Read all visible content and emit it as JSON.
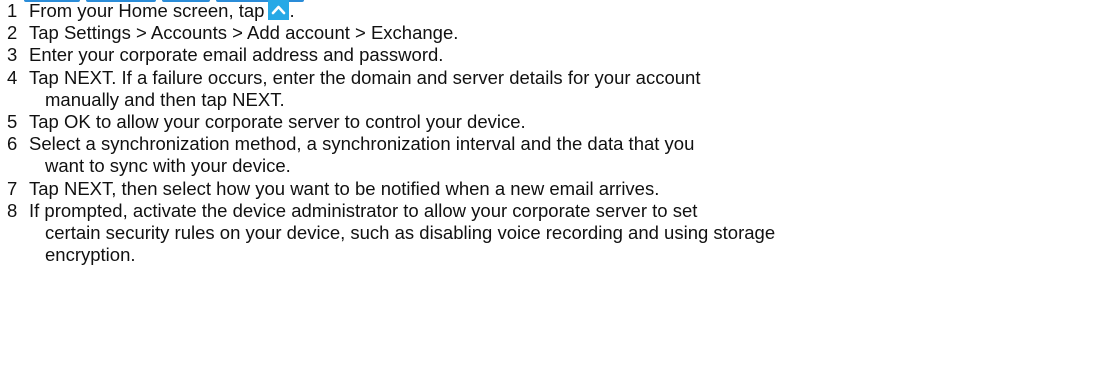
{
  "steps": [
    {
      "number": "1",
      "text_before_icon": "From your Home screen, tap",
      "icon": "up-arrow-icon",
      "text_after_icon": "."
    },
    {
      "number": "2",
      "lines": [
        "Tap Settings > Accounts  > Add account > Exchange."
      ]
    },
    {
      "number": "3",
      "lines": [
        "Enter your corporate email address and password."
      ]
    },
    {
      "number": "4",
      "lines": [
        "Tap NEXT. If a failure occurs, enter the domain and server details for your account",
        "manually and then tap NEXT."
      ]
    },
    {
      "number": "5",
      "lines": [
        "Tap OK to allow your corporate server to control your device."
      ]
    },
    {
      "number": "6",
      "lines": [
        "Select a synchronization method, a synchronization interval and the data that you",
        "want to sync with your device."
      ]
    },
    {
      "number": "7",
      "lines": [
        "Tap NEXT, then select how you want to be notified when a new email arrives."
      ]
    },
    {
      "number": "8",
      "lines": [
        "If prompted, activate the device administrator to allow your corporate server to set",
        "certain security rules on your device, such as disabling voice recording and using storage",
        "encryption."
      ]
    }
  ],
  "colors": {
    "text": "#111111",
    "icon_background": "#27a9e6",
    "heading_fragment": "#2a8cd8"
  }
}
